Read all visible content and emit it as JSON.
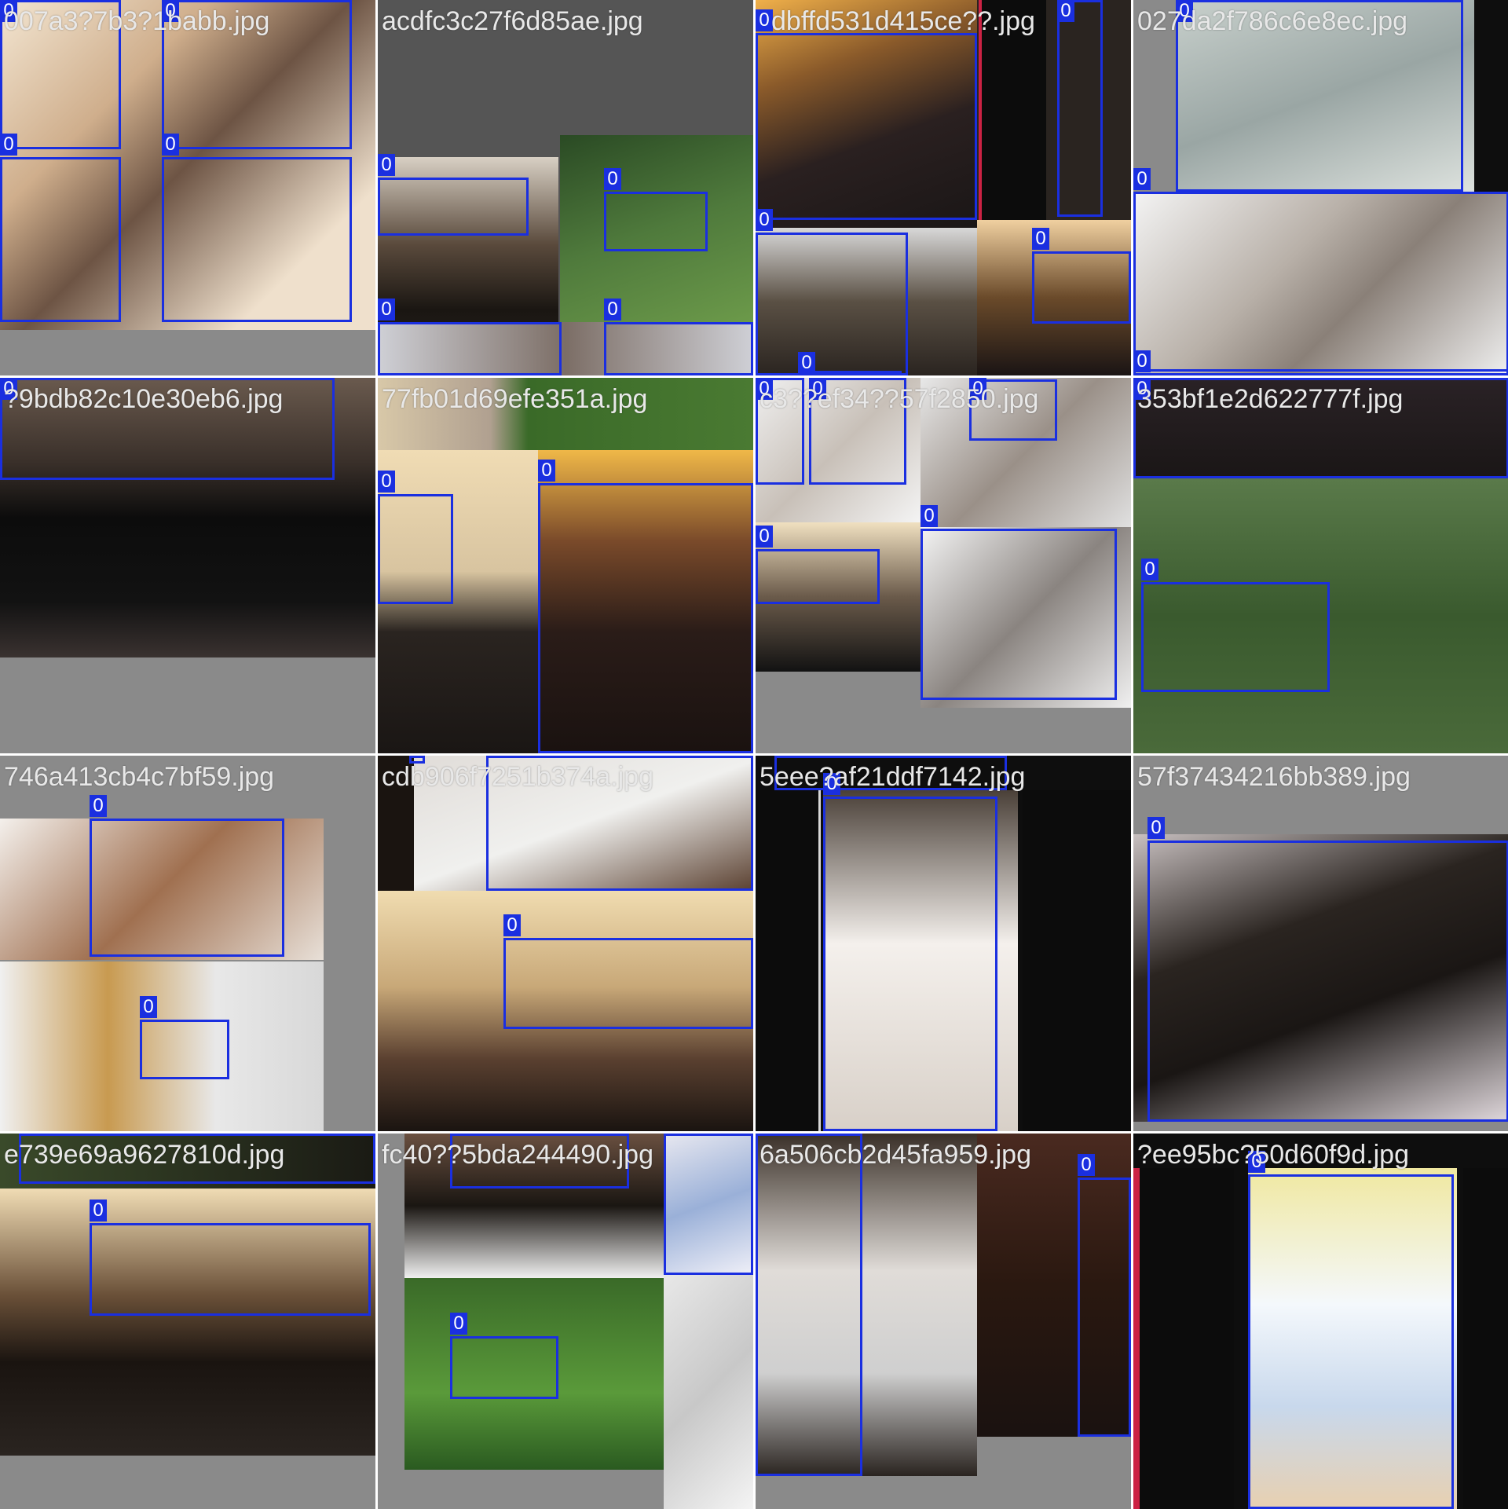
{
  "viewer": {
    "class_label": "0",
    "box_color": "#1a2fe0",
    "text_color": "#e8e8e8"
  },
  "tiles": [
    {
      "name": "007a3?7b3?1babb.jpg",
      "boxes": 4
    },
    {
      "name": "acdfc3c27f6d85ae.jpg",
      "boxes": 4
    },
    {
      "name": "dbffd531d415ce??.jpg",
      "boxes": 5
    },
    {
      "name": "027da2f786c6e8ec.jpg",
      "boxes": 3
    },
    {
      "name": "?9bdb82c10e30eb6.jpg",
      "boxes": 1
    },
    {
      "name": "77fb01d69efe351a.jpg",
      "boxes": 2
    },
    {
      "name": "c3??ef34??57f2850.jpg",
      "boxes": 5
    },
    {
      "name": "353bf1e2d622777f.jpg",
      "boxes": 2
    },
    {
      "name": "746a413cb4c7bf59.jpg",
      "boxes": 2
    },
    {
      "name": "cdb906f7251b374a.jpg",
      "boxes": 3
    },
    {
      "name": "5eee?af21ddf7142.jpg",
      "boxes": 2
    },
    {
      "name": "57f37434216bb389.jpg",
      "boxes": 1
    },
    {
      "name": "e739e69a9627810d.jpg",
      "boxes": 2
    },
    {
      "name": "fc40??5bda244490.jpg",
      "boxes": 3
    },
    {
      "name": "6a506cb2d45fa959.jpg",
      "boxes": 2
    },
    {
      "name": "?ee95bc?50d60f9d.jpg",
      "boxes": 1
    }
  ]
}
